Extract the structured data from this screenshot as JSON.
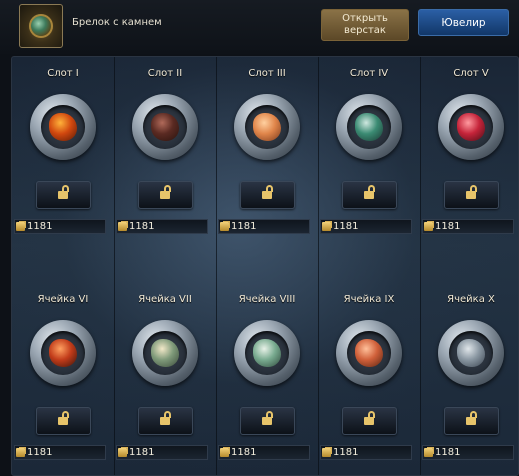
{
  "item": {
    "name": "Брелок с камнем",
    "icon": "amulet-icon"
  },
  "buttons": {
    "open_label": "Открыть верстак",
    "jeweler_label": "Ювелир"
  },
  "slots": [
    {
      "label": "Слот I",
      "price": "1181",
      "gem": [
        "#ffb23a",
        "#d1480f",
        "#5a1a06"
      ]
    },
    {
      "label": "Слот II",
      "price": "1181",
      "gem": [
        "#b06a5a",
        "#5a2a22",
        "#2a130e"
      ]
    },
    {
      "label": "Слот III",
      "price": "1181",
      "gem": [
        "#ffd0a0",
        "#e0854a",
        "#7a3a1c"
      ]
    },
    {
      "label": "Слот IV",
      "price": "1181",
      "gem": [
        "#cfe8e0",
        "#3b8b73",
        "#1a3a33"
      ]
    },
    {
      "label": "Слот V",
      "price": "1181",
      "gem": [
        "#ff9aa0",
        "#c5243a",
        "#4a0d16"
      ]
    },
    {
      "label": "Ячейка VI",
      "price": "1181",
      "gem": [
        "#ffa060",
        "#c23c1a",
        "#3a140a"
      ]
    },
    {
      "label": "Ячейка VII",
      "price": "1181",
      "gem": [
        "#f2e8c8",
        "#7f9a7a",
        "#3a4a3a"
      ]
    },
    {
      "label": "Ячейка VIII",
      "price": "1181",
      "gem": [
        "#e8f2e8",
        "#79ab90",
        "#2e4a3c"
      ]
    },
    {
      "label": "Ячейка IX",
      "price": "1181",
      "gem": [
        "#ffc09a",
        "#d0603a",
        "#5a2412"
      ]
    },
    {
      "label": "Ячейка X",
      "price": "1181",
      "gem": [
        "#e0e6ea",
        "#8a97a2",
        "#3a4450"
      ]
    }
  ]
}
